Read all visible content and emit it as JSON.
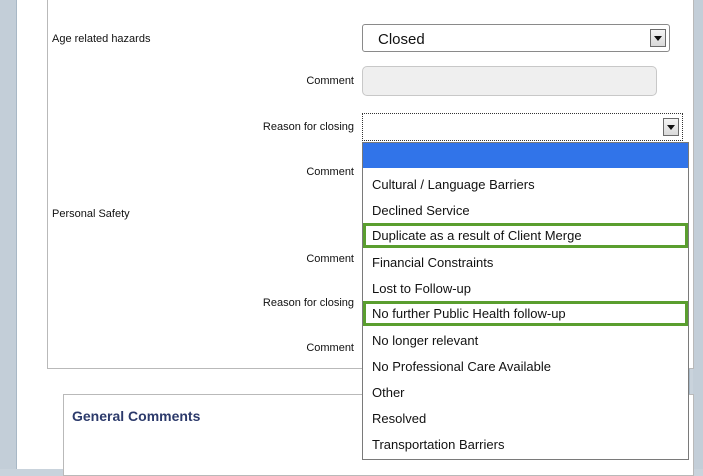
{
  "form": {
    "age_hazards_label": "Age related hazards",
    "age_hazards_value": "Closed",
    "comment_label": "Comment",
    "reason_label": "Reason for closing",
    "reason_value": "",
    "personal_safety_label": "Personal Safety"
  },
  "dropdown": {
    "options": [
      "",
      "Cultural / Language Barriers",
      "Declined Service",
      "Duplicate as a result of Client Merge",
      "Financial Constraints",
      "Lost to Follow-up",
      "No further Public Health follow-up",
      "No longer relevant",
      "No Professional Care Available",
      "Other",
      "Resolved",
      "Transportation Barriers"
    ],
    "selected_index": 0,
    "highlighted_indices": [
      3,
      6
    ]
  },
  "general": {
    "title": "General Comments"
  },
  "colors": {
    "selection_blue": "#3174e9",
    "highlight_green": "#5a9e2f",
    "title_navy": "#2c3a6b"
  }
}
